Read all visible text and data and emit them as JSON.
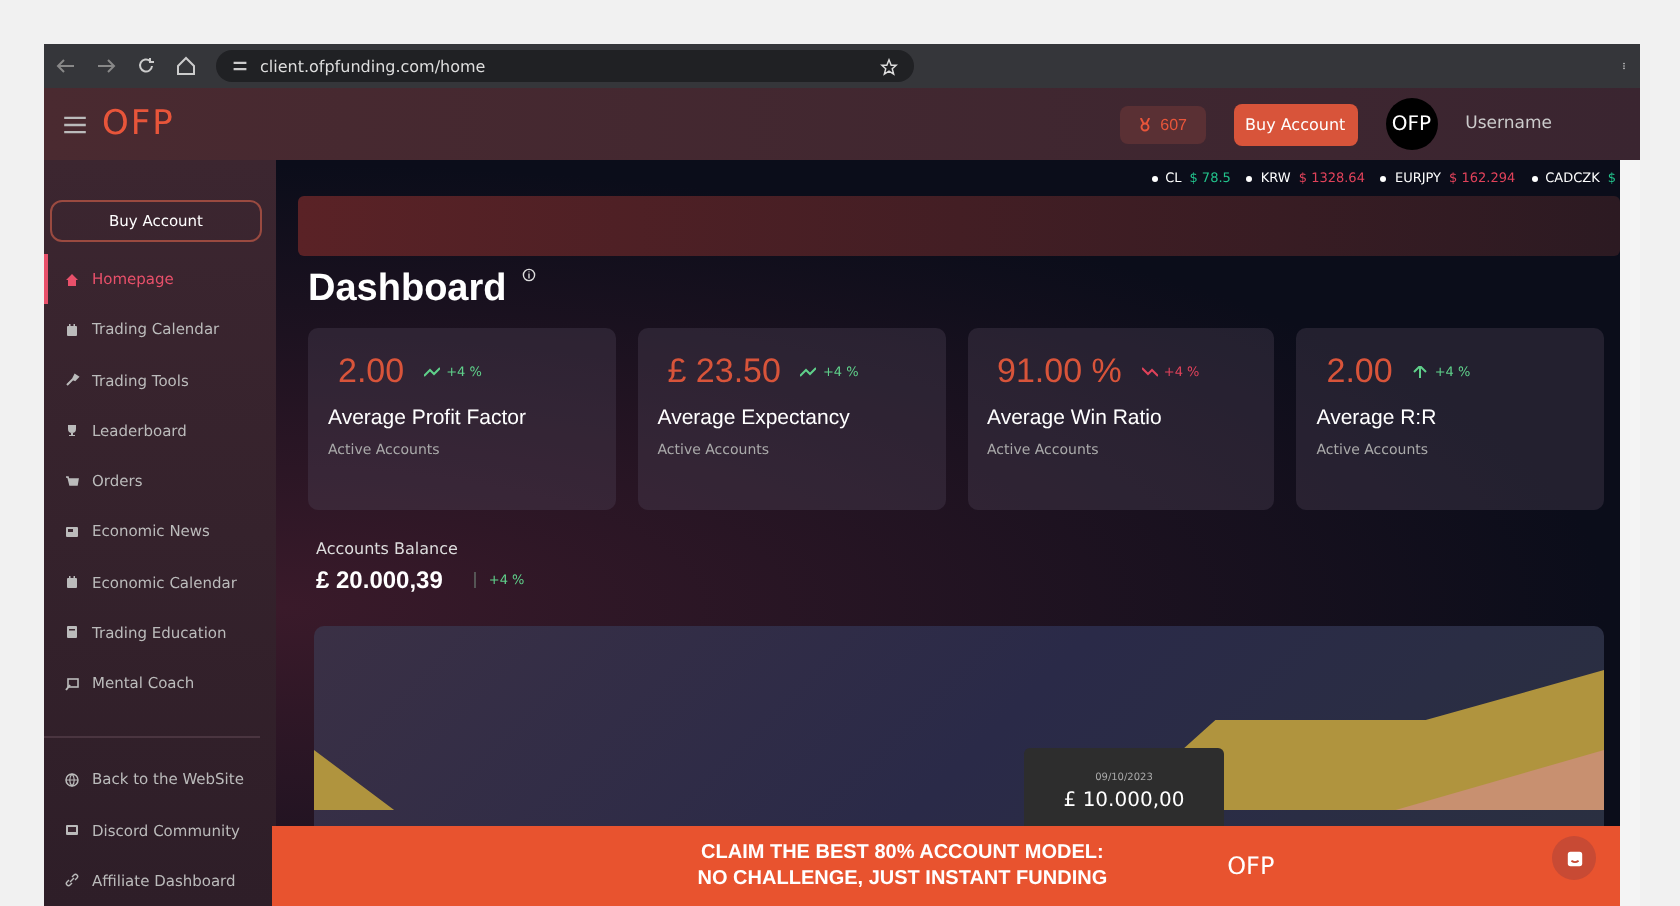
{
  "browser": {
    "url": "client.ofpfunding.com/home"
  },
  "header": {
    "logo": "OFP",
    "points": "607",
    "buy_button": "Buy Account",
    "avatar": "OFP",
    "username": "Username"
  },
  "sidebar": {
    "buy_button": "Buy Account",
    "items": [
      {
        "label": "Homepage",
        "selected": true
      },
      {
        "label": "Trading Calendar",
        "selected": false
      },
      {
        "label": "Trading Tools",
        "selected": false
      },
      {
        "label": "Leaderboard",
        "selected": false
      },
      {
        "label": "Orders",
        "selected": false
      },
      {
        "label": "Economic News",
        "selected": false
      },
      {
        "label": "Economic Calendar",
        "selected": false
      },
      {
        "label": "Trading Education",
        "selected": false
      },
      {
        "label": "Mental Coach",
        "selected": false
      }
    ],
    "footer_items": [
      {
        "label": "Back to the WebSite"
      },
      {
        "label": "Discord Community"
      },
      {
        "label": "Affiliate Dashboard"
      }
    ]
  },
  "ticker": [
    {
      "symbol": "CL",
      "price": "$ 78.5",
      "color": "#22c08a"
    },
    {
      "symbol": "KRW",
      "price": "$ 1328.64",
      "color": "#e0425a"
    },
    {
      "symbol": "EURJPY",
      "price": "$ 162.294",
      "color": "#e0425a"
    },
    {
      "symbol": "CADCZK",
      "price": "$",
      "color": "#22c08a"
    }
  ],
  "dashboard": {
    "title": "Dashboard",
    "cards": [
      {
        "value": "2.00",
        "kind": "trend-up",
        "change": "+4 %",
        "title": "Average Profit Factor",
        "subtitle": "Active Accounts"
      },
      {
        "value": "£ 23.50",
        "kind": "trend-up",
        "change": "+4 %",
        "title": "Average Expectancy",
        "subtitle": "Active Accounts"
      },
      {
        "value": "91.00 %",
        "kind": "trend-down",
        "change": "+4 %",
        "title": "Average Win Ratio",
        "subtitle": "Active Accounts"
      },
      {
        "value": "2.00",
        "kind": "arrow-up",
        "change": "+4 %",
        "title": "Average R:R",
        "subtitle": "Active Accounts"
      }
    ],
    "balance": {
      "label": "Accounts Balance",
      "value": "£ 20.000,39",
      "change": "+4 %"
    },
    "chart_tooltip": {
      "date": "09/10/2023",
      "value": "£ 10.000,00"
    }
  },
  "banner": {
    "lines": [
      "CLAIM THE BEST 80% ACCOUNT MODEL:",
      "NO CHALLENGE, JUST INSTANT FUNDING"
    ],
    "logo": "OFP"
  }
}
